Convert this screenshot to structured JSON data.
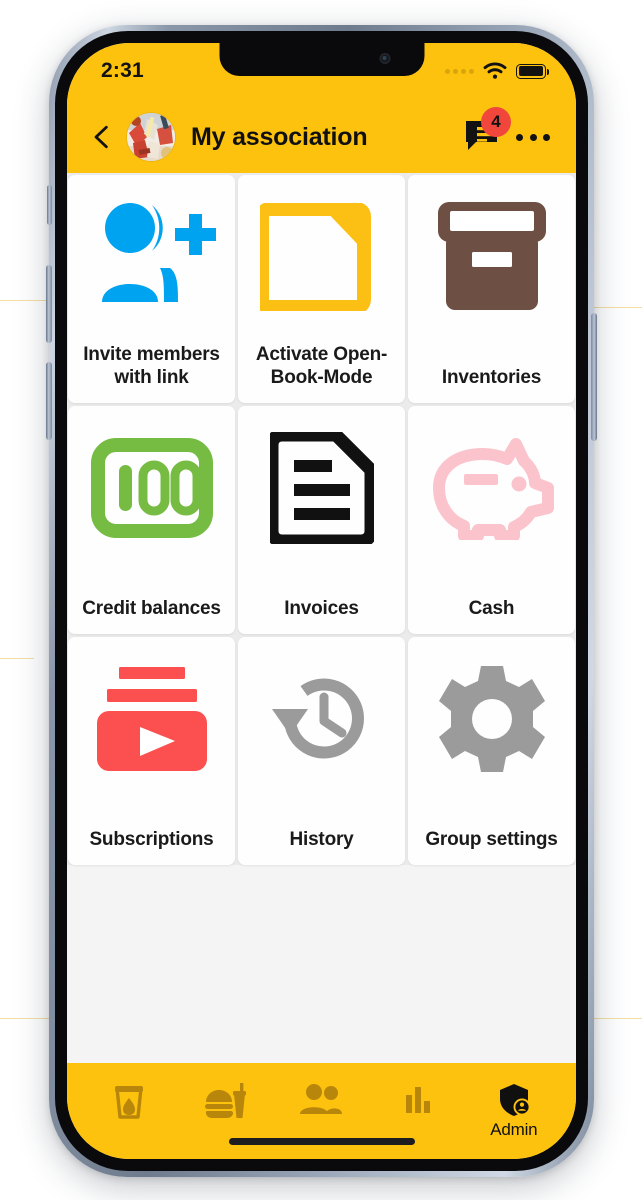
{
  "status_bar": {
    "time": "2:31",
    "signal_icon": "signal-dots-icon",
    "wifi_icon": "wifi-icon",
    "battery_icon": "battery-full-icon"
  },
  "header": {
    "back_icon": "back-chevron-icon",
    "avatar_icon": "group-avatar-photo",
    "title": "My association",
    "messages_icon": "chat-bubble-icon",
    "messages_badge": "4",
    "overflow_icon": "more-options-icon",
    "background_color": "#FDC20E",
    "badge_color": "#F0463C"
  },
  "grid": {
    "tiles": [
      {
        "label": "Invite members with link",
        "icon": "invite-members-icon",
        "color": "#00A3F0"
      },
      {
        "label": "Activate Open-Book-Mode",
        "icon": "folder-open-icon",
        "color": "#FCC015"
      },
      {
        "label": "Inventories",
        "icon": "archive-box-icon",
        "color": "#6E4F43"
      },
      {
        "label": "Credit balances",
        "icon": "hundred-credits-icon",
        "color": "#76BC43"
      },
      {
        "label": "Invoices",
        "icon": "document-invoice-icon",
        "color": "#111111"
      },
      {
        "label": "Cash",
        "icon": "piggy-bank-icon",
        "color": "#FBC4CC"
      },
      {
        "label": "Subscriptions",
        "icon": "subscriptions-play-icon",
        "color": "#FC5050"
      },
      {
        "label": "History",
        "icon": "history-clock-icon",
        "color": "#9B9B9B"
      },
      {
        "label": "Group settings",
        "icon": "gear-settings-icon",
        "color": "#9B9B9B"
      }
    ]
  },
  "bottom_nav": {
    "items": [
      {
        "label": "",
        "icon": "drink-glass-icon",
        "active": false
      },
      {
        "label": "",
        "icon": "food-meal-icon",
        "active": false
      },
      {
        "label": "",
        "icon": "members-people-icon",
        "active": false
      },
      {
        "label": "",
        "icon": "statistics-bars-icon",
        "active": false
      },
      {
        "label": "Admin",
        "icon": "admin-shield-icon",
        "active": true
      }
    ],
    "background_color": "#FDC20E",
    "inactive_color": "#B8860B",
    "active_color": "#101010"
  }
}
